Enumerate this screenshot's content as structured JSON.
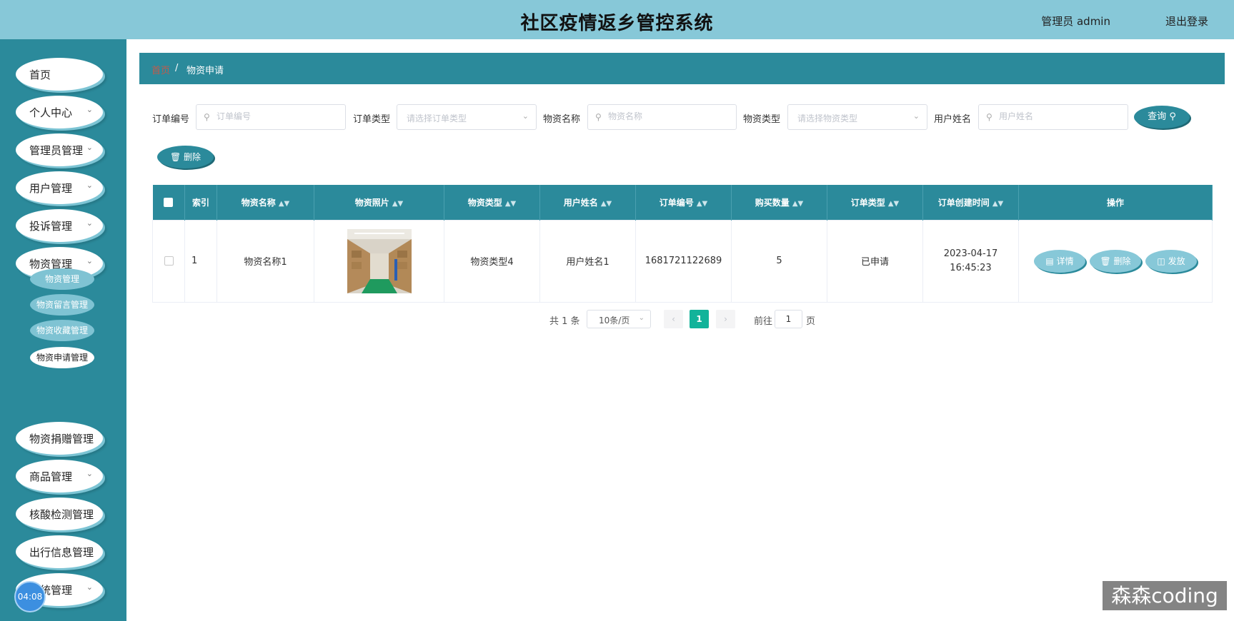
{
  "header": {
    "title": "社区疫情返乡管控系统",
    "admin": "管理员 admin",
    "logout": "退出登录"
  },
  "sidebar": {
    "items": [
      {
        "label": "首页",
        "chevron": false
      },
      {
        "label": "个人中心",
        "chevron": true
      },
      {
        "label": "管理员管理",
        "chevron": true
      },
      {
        "label": "用户管理",
        "chevron": true
      },
      {
        "label": "投诉管理",
        "chevron": true
      },
      {
        "label": "物资管理",
        "chevron": true
      },
      {
        "label": "物资捐赠管理",
        "chevron": false
      },
      {
        "label": "商品管理",
        "chevron": true
      },
      {
        "label": "核酸检测管理",
        "chevron": false
      },
      {
        "label": "出行信息管理",
        "chevron": false
      },
      {
        "label": "统管理",
        "chevron": true
      }
    ],
    "subitems": [
      {
        "label": "物资管理",
        "active": false
      },
      {
        "label": "物资留言管理",
        "active": false
      },
      {
        "label": "物资收藏管理",
        "active": false
      },
      {
        "label": "物资申请管理",
        "active": true
      }
    ],
    "timer": "04:08"
  },
  "breadcrumb": {
    "home": "首页",
    "separator": "/",
    "current": "物资申请"
  },
  "filters": {
    "order_no": {
      "label": "订单编号",
      "placeholder": "订单编号"
    },
    "order_type": {
      "label": "订单类型",
      "placeholder": "请选择订单类型"
    },
    "material_name": {
      "label": "物资名称",
      "placeholder": "物资名称"
    },
    "material_type": {
      "label": "物资类型",
      "placeholder": "请选择物资类型"
    },
    "user_name": {
      "label": "用户姓名",
      "placeholder": "用户姓名"
    },
    "query_button": "查询"
  },
  "toolbar": {
    "delete_label": "删除"
  },
  "table": {
    "columns": [
      "索引",
      "物资名称",
      "物资照片",
      "物资类型",
      "用户姓名",
      "订单编号",
      "购买数量",
      "订单类型",
      "订单创建时间",
      "操作"
    ],
    "rows": [
      {
        "index": "1",
        "material_name": "物资名称1",
        "material_type": "物资类型4",
        "user_name": "用户姓名1",
        "order_no": "1681721122689",
        "quantity": "5",
        "order_type": "已申请",
        "created_at": "2023-04-17 16:45:23"
      }
    ],
    "actions": {
      "detail": "详情",
      "delete": "删除",
      "issue": "发放"
    }
  },
  "pagination": {
    "total": "共 1 条",
    "page_size": "10条/页",
    "current_page": "1",
    "goto_prefix": "前往",
    "goto_value": "1",
    "goto_suffix": "页"
  },
  "watermark": "森森coding",
  "colors": {
    "primary": "#2b8a9b",
    "header": "#87c8d8",
    "light": "#87c8d8",
    "active_page": "#12b39a"
  }
}
